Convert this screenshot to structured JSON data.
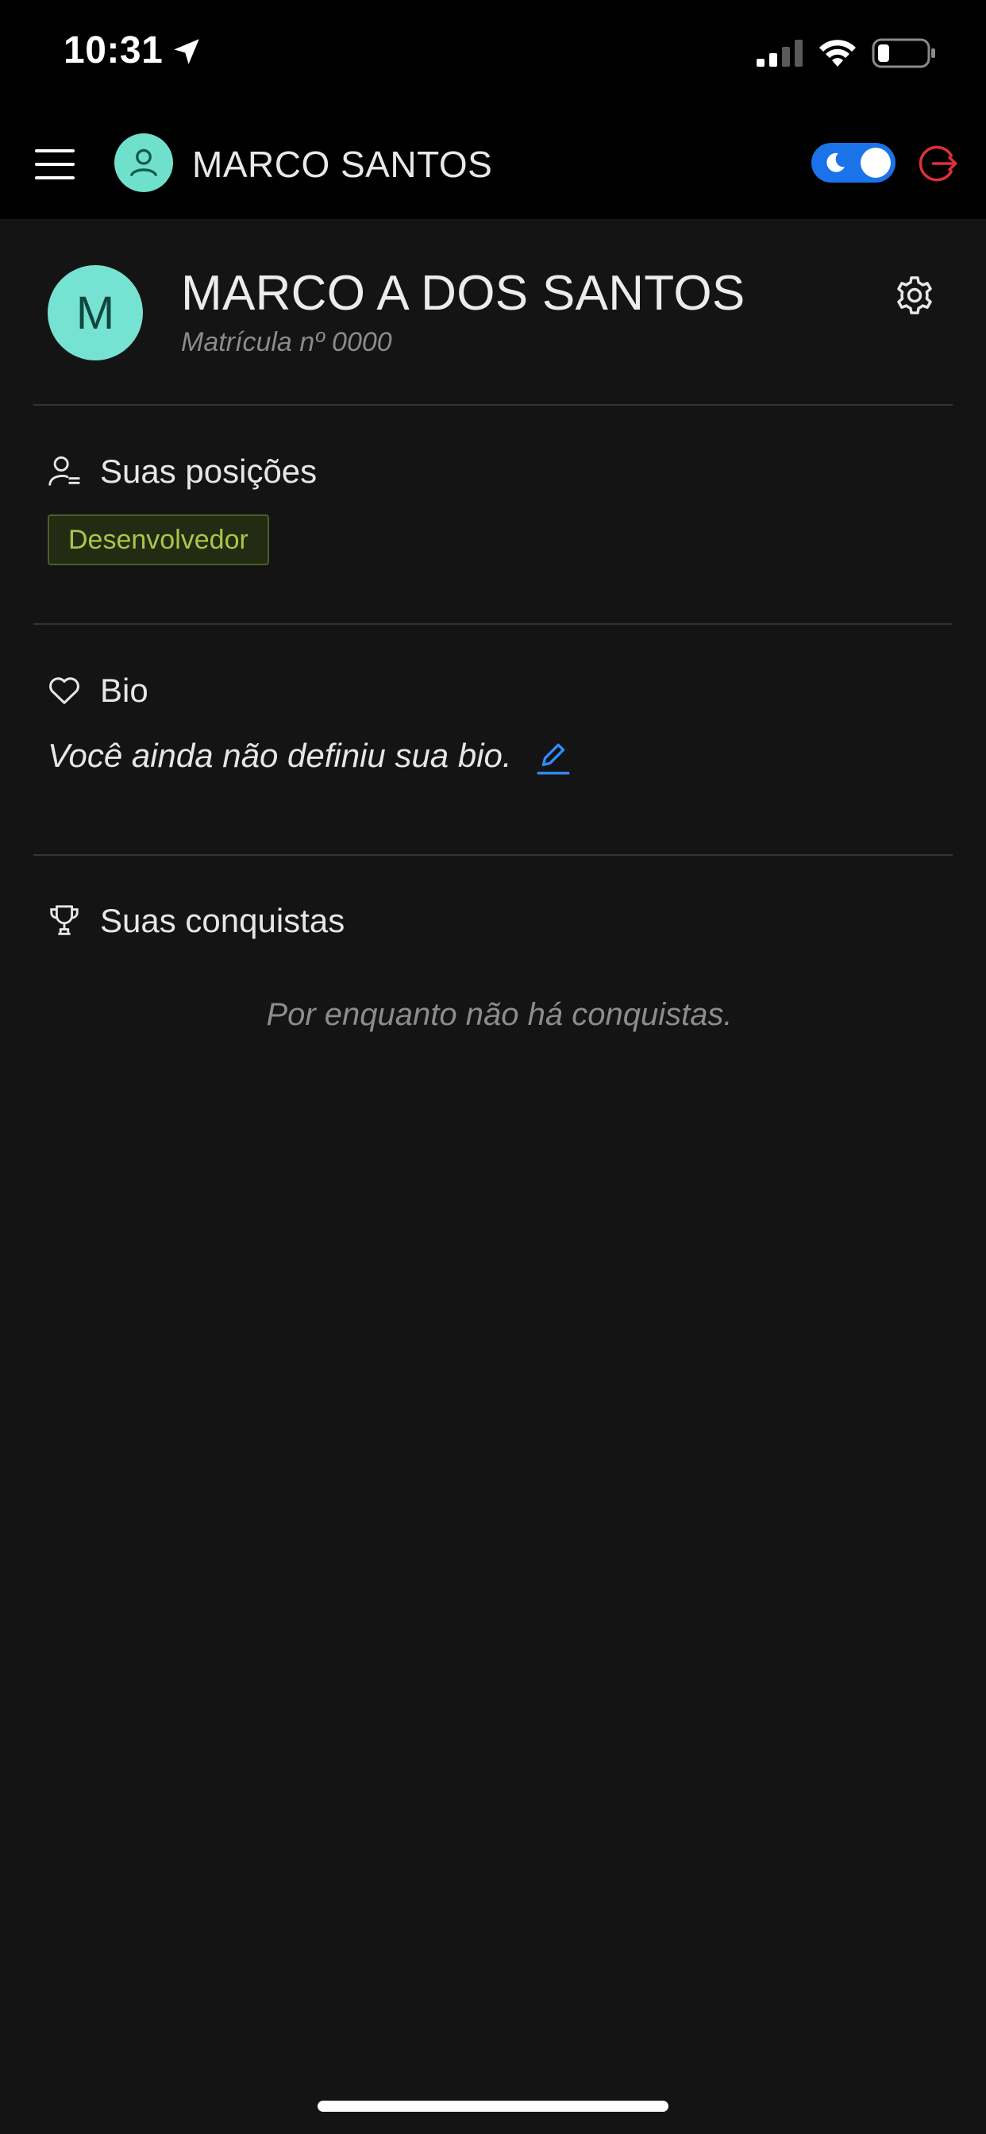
{
  "status_bar": {
    "time": "10:31"
  },
  "header": {
    "user_name": "MARCO SANTOS",
    "icons": {
      "menu": "hamburger-menu-icon",
      "avatar": "user-icon",
      "theme": "moon-icon",
      "logout": "logout-icon"
    },
    "colors": {
      "avatar": "#6fe0cc",
      "toggle": "#1a73e8",
      "logout": "#e0303a"
    },
    "dark_mode": true
  },
  "profile": {
    "initial": "M",
    "full_name": "MARCO A DOS SANTOS",
    "matricula": "Matrícula nº 0000"
  },
  "positions": {
    "title": "Suas posições",
    "items": [
      "Desenvolvedor"
    ]
  },
  "bio": {
    "title": "Bio",
    "text": "Você ainda não definiu sua bio."
  },
  "achievements": {
    "title": "Suas conquistas",
    "empty_message": "Por enquanto não há conquistas."
  }
}
